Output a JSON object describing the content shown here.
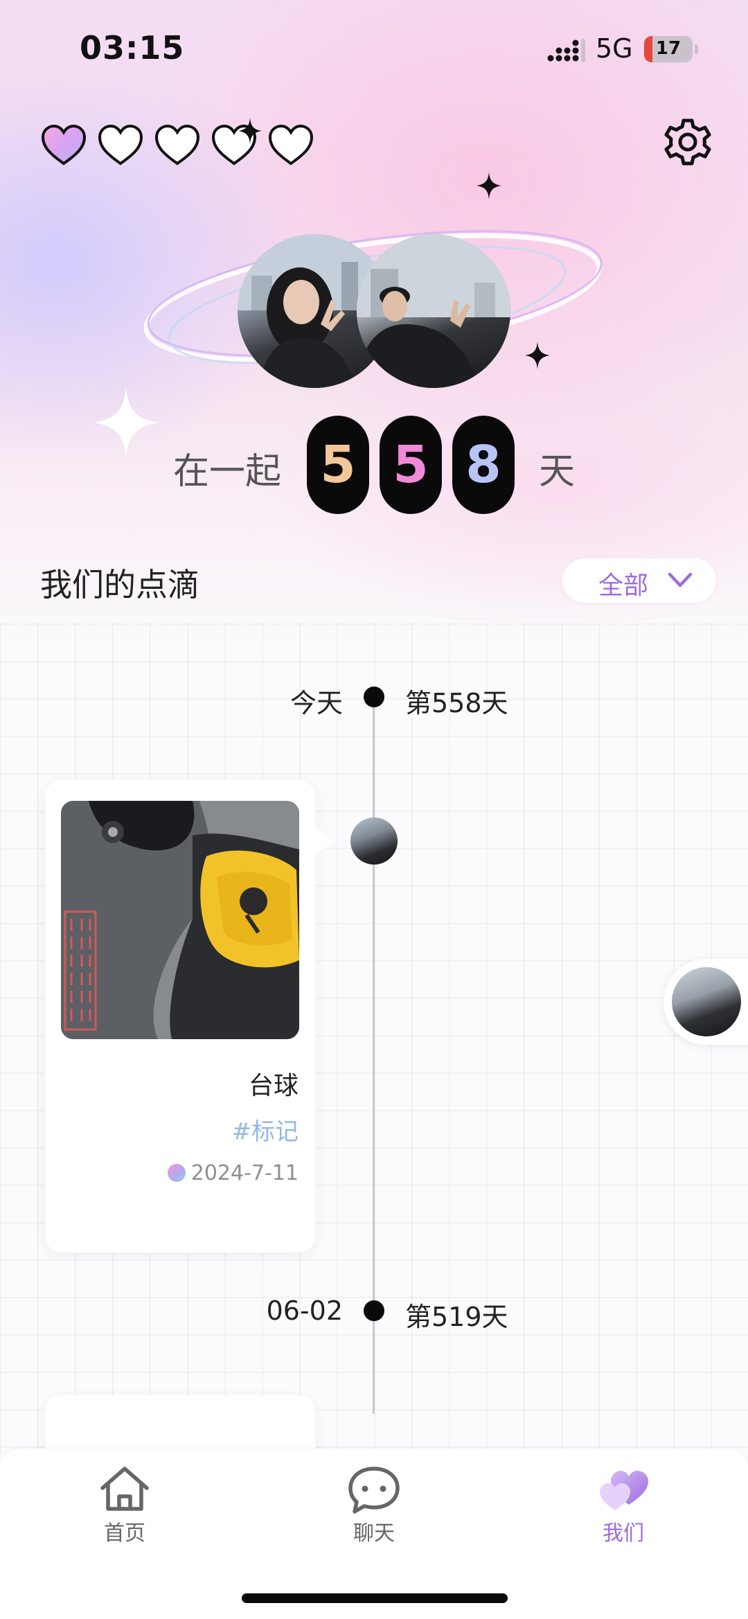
{
  "status_bar": {
    "time": "03:15",
    "network": "5G",
    "battery": "17"
  },
  "header": {
    "hearts": [
      {
        "filled": true
      },
      {
        "filled": false
      },
      {
        "filled": false
      },
      {
        "filled": false
      },
      {
        "filled": false
      }
    ],
    "settings_icon": "gear-icon"
  },
  "counter": {
    "prefix": "在一起",
    "digits": [
      "5",
      "5",
      "8"
    ],
    "suffix": "天"
  },
  "section": {
    "title": "我们的点滴",
    "filter_label": "全部"
  },
  "timeline": [
    {
      "left": "今天",
      "right": "第558天"
    },
    {
      "left": "06-02",
      "right": "第519天"
    }
  ],
  "card": {
    "title": "台球",
    "tag": "#标记",
    "date": "2024-7-11"
  },
  "nav": [
    {
      "label": "首页",
      "icon": "home-icon",
      "active": false
    },
    {
      "label": "聊天",
      "icon": "chat-icon",
      "active": false
    },
    {
      "label": "我们",
      "icon": "hearts-icon",
      "active": true
    }
  ],
  "colors": {
    "accent": "#9b6ce0",
    "tag": "#94b7e6",
    "digit1": "#f3c79a",
    "digit2": "#f08ad7",
    "digit3": "#b7c4f5"
  }
}
